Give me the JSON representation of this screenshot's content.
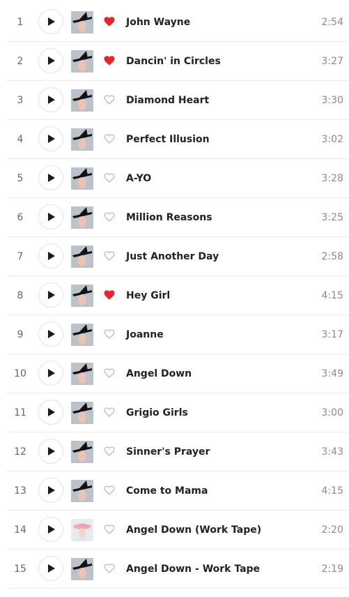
{
  "colors": {
    "liked_heart": "#e0282e",
    "unliked_heart": "#bdbdbd",
    "play_icon": "#1a1a1a",
    "duration_text": "#8a8a8a",
    "divider": "#ebebeb"
  },
  "icons": {
    "play": "play-icon",
    "heart_filled": "heart-filled-icon",
    "heart_outline": "heart-outline-icon",
    "album_cover": "album-art-icon"
  },
  "tracks": [
    {
      "number": "1",
      "title": "John Wayne",
      "duration": "2:54",
      "liked": true,
      "cover": "joanne"
    },
    {
      "number": "2",
      "title": "Dancin' in Circles",
      "duration": "3:27",
      "liked": true,
      "cover": "joanne"
    },
    {
      "number": "3",
      "title": "Diamond Heart",
      "duration": "3:30",
      "liked": false,
      "cover": "joanne"
    },
    {
      "number": "4",
      "title": "Perfect Illusion",
      "duration": "3:02",
      "liked": false,
      "cover": "joanne"
    },
    {
      "number": "5",
      "title": "A-YO",
      "duration": "3:28",
      "liked": false,
      "cover": "joanne"
    },
    {
      "number": "6",
      "title": "Million Reasons",
      "duration": "3:25",
      "liked": false,
      "cover": "joanne"
    },
    {
      "number": "7",
      "title": "Just Another Day",
      "duration": "2:58",
      "liked": false,
      "cover": "joanne"
    },
    {
      "number": "8",
      "title": "Hey Girl",
      "duration": "4:15",
      "liked": true,
      "cover": "joanne"
    },
    {
      "number": "9",
      "title": "Joanne",
      "duration": "3:17",
      "liked": false,
      "cover": "joanne"
    },
    {
      "number": "10",
      "title": "Angel Down",
      "duration": "3:49",
      "liked": false,
      "cover": "joanne"
    },
    {
      "number": "11",
      "title": "Grigio Girls",
      "duration": "3:00",
      "liked": false,
      "cover": "joanne"
    },
    {
      "number": "12",
      "title": "Sinner's Prayer",
      "duration": "3:43",
      "liked": false,
      "cover": "joanne"
    },
    {
      "number": "13",
      "title": "Come to Mama",
      "duration": "4:15",
      "liked": false,
      "cover": "joanne"
    },
    {
      "number": "14",
      "title": "Angel Down (Work Tape)",
      "duration": "2:20",
      "liked": false,
      "cover": "pink-hat"
    },
    {
      "number": "15",
      "title": "Angel Down - Work Tape",
      "duration": "2:19",
      "liked": false,
      "cover": "joanne"
    }
  ]
}
